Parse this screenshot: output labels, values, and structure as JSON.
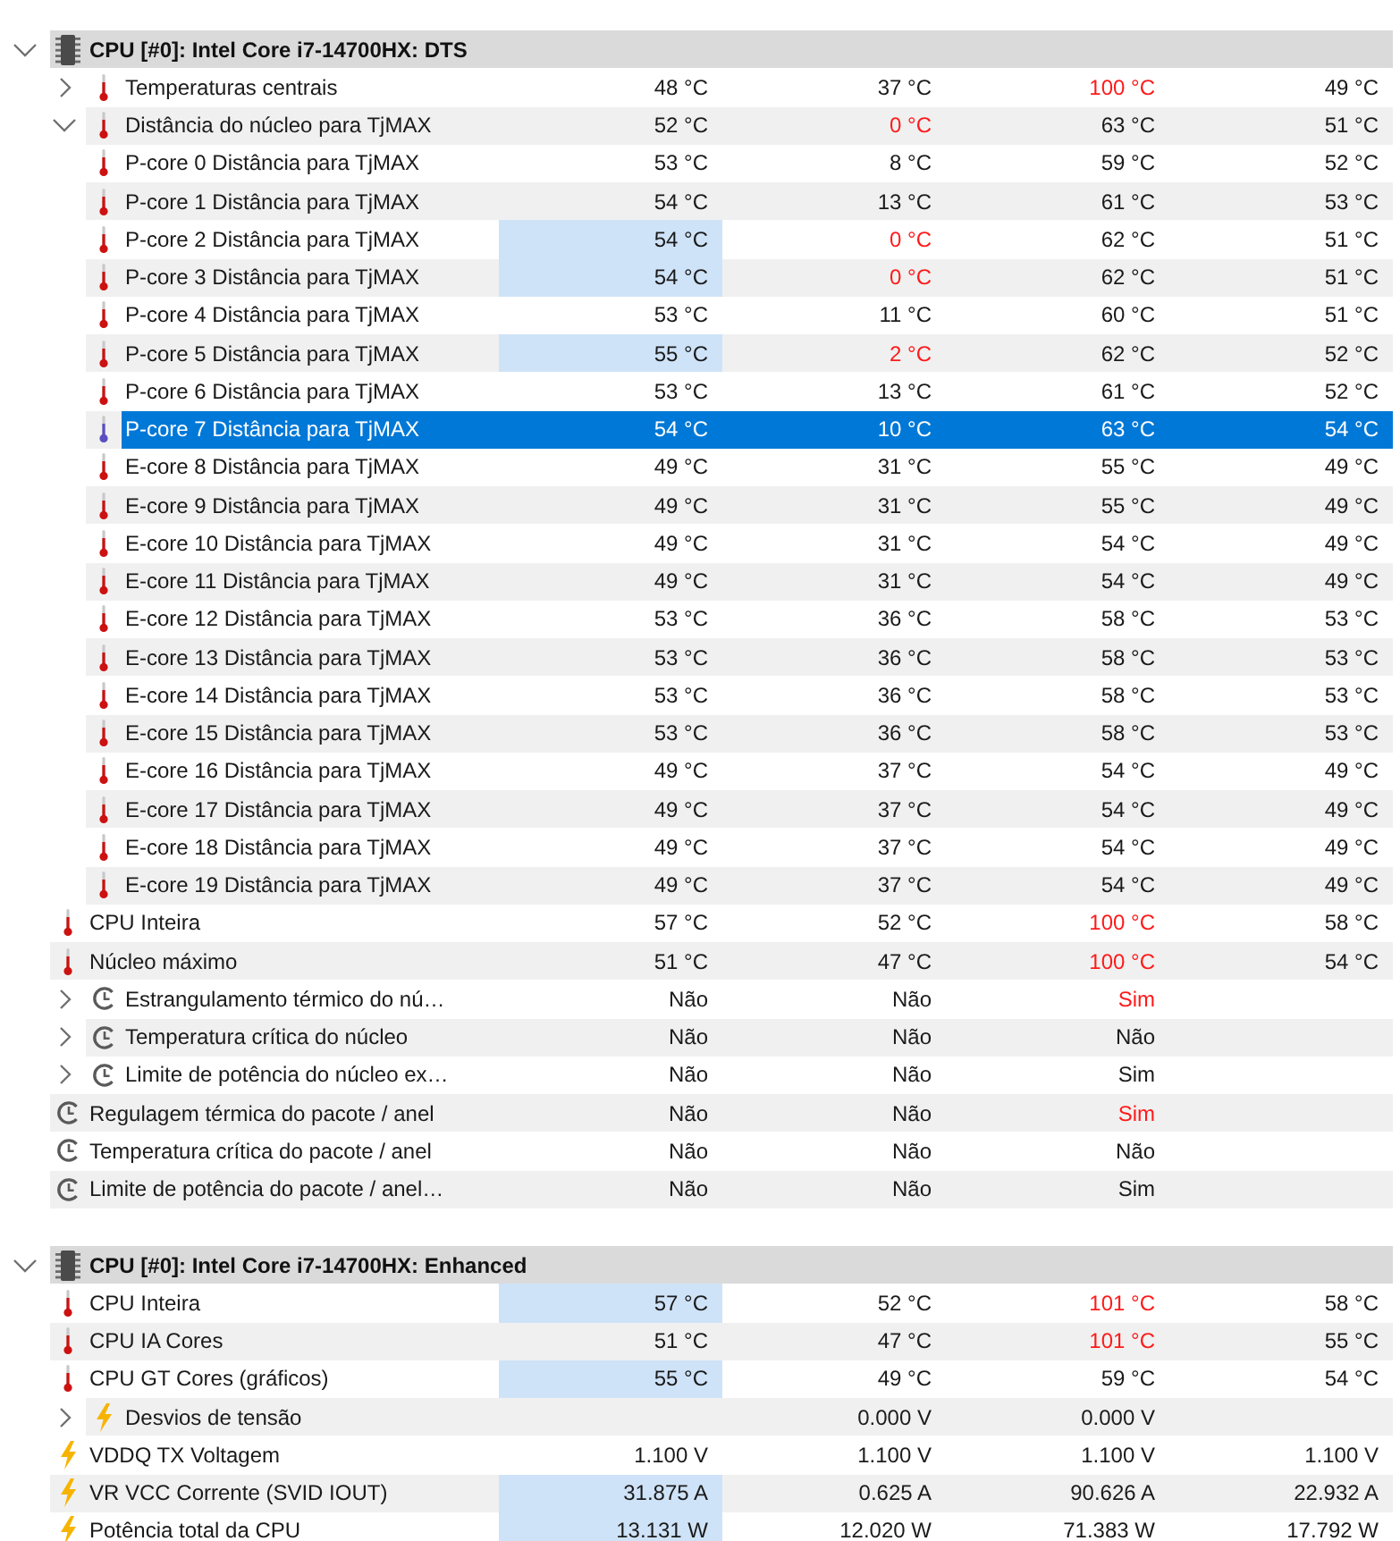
{
  "sections": [
    {
      "title": "CPU [#0]: Intel Core i7-14700HX: DTS",
      "expanded": true,
      "items": [
        {
          "kind": "temperature",
          "label": "Temperaturas centrais",
          "expanded": false,
          "selected": false,
          "highlighted": false,
          "cells": {
            "column_1": {
              "text": "48 °C",
              "alert": false
            },
            "column_2": {
              "text": "37 °C",
              "alert": false
            },
            "column_3": {
              "text": "100 °C",
              "alert": true
            },
            "column_4": {
              "text": "49 °C",
              "alert": false
            }
          }
        },
        {
          "kind": "temperature",
          "label": "Distância do núcleo para TjMAX",
          "expanded": true,
          "selected": false,
          "highlighted": false,
          "cells": {
            "column_1": {
              "text": "52 °C",
              "alert": false
            },
            "column_2": {
              "text": "0 °C",
              "alert": true
            },
            "column_3": {
              "text": "63 °C",
              "alert": false
            },
            "column_4": {
              "text": "51 °C",
              "alert": false
            }
          },
          "children": [
            {
              "kind": "temperature",
              "label": "P-core 0 Distância para TjMAX",
              "selected": false,
              "highlighted": false,
              "cells": {
                "column_1": {
                  "text": "53 °C",
                  "alert": false
                },
                "column_2": {
                  "text": "8 °C",
                  "alert": false
                },
                "column_3": {
                  "text": "59 °C",
                  "alert": false
                },
                "column_4": {
                  "text": "52 °C",
                  "alert": false
                }
              }
            },
            {
              "kind": "temperature",
              "label": "P-core 1 Distância para TjMAX",
              "selected": false,
              "highlighted": false,
              "cells": {
                "column_1": {
                  "text": "54 °C",
                  "alert": false
                },
                "column_2": {
                  "text": "13 °C",
                  "alert": false
                },
                "column_3": {
                  "text": "61 °C",
                  "alert": false
                },
                "column_4": {
                  "text": "53 °C",
                  "alert": false
                }
              }
            },
            {
              "kind": "temperature",
              "label": "P-core 2 Distância para TjMAX",
              "selected": false,
              "highlighted": true,
              "cells": {
                "column_1": {
                  "text": "54 °C",
                  "alert": false
                },
                "column_2": {
                  "text": "0 °C",
                  "alert": true
                },
                "column_3": {
                  "text": "62 °C",
                  "alert": false
                },
                "column_4": {
                  "text": "51 °C",
                  "alert": false
                }
              }
            },
            {
              "kind": "temperature",
              "label": "P-core 3 Distância para TjMAX",
              "selected": false,
              "highlighted": true,
              "cells": {
                "column_1": {
                  "text": "54 °C",
                  "alert": false
                },
                "column_2": {
                  "text": "0 °C",
                  "alert": true
                },
                "column_3": {
                  "text": "62 °C",
                  "alert": false
                },
                "column_4": {
                  "text": "51 °C",
                  "alert": false
                }
              }
            },
            {
              "kind": "temperature",
              "label": "P-core 4 Distância para TjMAX",
              "selected": false,
              "highlighted": false,
              "cells": {
                "column_1": {
                  "text": "53 °C",
                  "alert": false
                },
                "column_2": {
                  "text": "11 °C",
                  "alert": false
                },
                "column_3": {
                  "text": "60 °C",
                  "alert": false
                },
                "column_4": {
                  "text": "51 °C",
                  "alert": false
                }
              }
            },
            {
              "kind": "temperature",
              "label": "P-core 5 Distância para TjMAX",
              "selected": false,
              "highlighted": true,
              "cells": {
                "column_1": {
                  "text": "55 °C",
                  "alert": false
                },
                "column_2": {
                  "text": "2 °C",
                  "alert": true
                },
                "column_3": {
                  "text": "62 °C",
                  "alert": false
                },
                "column_4": {
                  "text": "52 °C",
                  "alert": false
                }
              }
            },
            {
              "kind": "temperature",
              "label": "P-core 6 Distância para TjMAX",
              "selected": false,
              "highlighted": false,
              "cells": {
                "column_1": {
                  "text": "53 °C",
                  "alert": false
                },
                "column_2": {
                  "text": "13 °C",
                  "alert": false
                },
                "column_3": {
                  "text": "61 °C",
                  "alert": false
                },
                "column_4": {
                  "text": "52 °C",
                  "alert": false
                }
              }
            },
            {
              "kind": "temperature",
              "label": "P-core 7 Distância para TjMAX",
              "selected": true,
              "highlighted": false,
              "cells": {
                "column_1": {
                  "text": "54 °C",
                  "alert": false
                },
                "column_2": {
                  "text": "10 °C",
                  "alert": false
                },
                "column_3": {
                  "text": "63 °C",
                  "alert": false
                },
                "column_4": {
                  "text": "54 °C",
                  "alert": false
                }
              }
            },
            {
              "kind": "temperature",
              "label": "E-core 8 Distância para TjMAX",
              "selected": false,
              "highlighted": false,
              "cells": {
                "column_1": {
                  "text": "49 °C",
                  "alert": false
                },
                "column_2": {
                  "text": "31 °C",
                  "alert": false
                },
                "column_3": {
                  "text": "55 °C",
                  "alert": false
                },
                "column_4": {
                  "text": "49 °C",
                  "alert": false
                }
              }
            },
            {
              "kind": "temperature",
              "label": "E-core 9 Distância para TjMAX",
              "selected": false,
              "highlighted": false,
              "cells": {
                "column_1": {
                  "text": "49 °C",
                  "alert": false
                },
                "column_2": {
                  "text": "31 °C",
                  "alert": false
                },
                "column_3": {
                  "text": "55 °C",
                  "alert": false
                },
                "column_4": {
                  "text": "49 °C",
                  "alert": false
                }
              }
            },
            {
              "kind": "temperature",
              "label": "E-core 10 Distância para TjMAX",
              "selected": false,
              "highlighted": false,
              "cells": {
                "column_1": {
                  "text": "49 °C",
                  "alert": false
                },
                "column_2": {
                  "text": "31 °C",
                  "alert": false
                },
                "column_3": {
                  "text": "54 °C",
                  "alert": false
                },
                "column_4": {
                  "text": "49 °C",
                  "alert": false
                }
              }
            },
            {
              "kind": "temperature",
              "label": "E-core 11 Distância para TjMAX",
              "selected": false,
              "highlighted": false,
              "cells": {
                "column_1": {
                  "text": "49 °C",
                  "alert": false
                },
                "column_2": {
                  "text": "31 °C",
                  "alert": false
                },
                "column_3": {
                  "text": "54 °C",
                  "alert": false
                },
                "column_4": {
                  "text": "49 °C",
                  "alert": false
                }
              }
            },
            {
              "kind": "temperature",
              "label": "E-core 12 Distância para TjMAX",
              "selected": false,
              "highlighted": false,
              "cells": {
                "column_1": {
                  "text": "53 °C",
                  "alert": false
                },
                "column_2": {
                  "text": "36 °C",
                  "alert": false
                },
                "column_3": {
                  "text": "58 °C",
                  "alert": false
                },
                "column_4": {
                  "text": "53 °C",
                  "alert": false
                }
              }
            },
            {
              "kind": "temperature",
              "label": "E-core 13 Distância para TjMAX",
              "selected": false,
              "highlighted": false,
              "cells": {
                "column_1": {
                  "text": "53 °C",
                  "alert": false
                },
                "column_2": {
                  "text": "36 °C",
                  "alert": false
                },
                "column_3": {
                  "text": "58 °C",
                  "alert": false
                },
                "column_4": {
                  "text": "53 °C",
                  "alert": false
                }
              }
            },
            {
              "kind": "temperature",
              "label": "E-core 14 Distância para TjMAX",
              "selected": false,
              "highlighted": false,
              "cells": {
                "column_1": {
                  "text": "53 °C",
                  "alert": false
                },
                "column_2": {
                  "text": "36 °C",
                  "alert": false
                },
                "column_3": {
                  "text": "58 °C",
                  "alert": false
                },
                "column_4": {
                  "text": "53 °C",
                  "alert": false
                }
              }
            },
            {
              "kind": "temperature",
              "label": "E-core 15 Distância para TjMAX",
              "selected": false,
              "highlighted": false,
              "cells": {
                "column_1": {
                  "text": "53 °C",
                  "alert": false
                },
                "column_2": {
                  "text": "36 °C",
                  "alert": false
                },
                "column_3": {
                  "text": "58 °C",
                  "alert": false
                },
                "column_4": {
                  "text": "53 °C",
                  "alert": false
                }
              }
            },
            {
              "kind": "temperature",
              "label": "E-core 16 Distância para TjMAX",
              "selected": false,
              "highlighted": false,
              "cells": {
                "column_1": {
                  "text": "49 °C",
                  "alert": false
                },
                "column_2": {
                  "text": "37 °C",
                  "alert": false
                },
                "column_3": {
                  "text": "54 °C",
                  "alert": false
                },
                "column_4": {
                  "text": "49 °C",
                  "alert": false
                }
              }
            },
            {
              "kind": "temperature",
              "label": "E-core 17 Distância para TjMAX",
              "selected": false,
              "highlighted": false,
              "cells": {
                "column_1": {
                  "text": "49 °C",
                  "alert": false
                },
                "column_2": {
                  "text": "37 °C",
                  "alert": false
                },
                "column_3": {
                  "text": "54 °C",
                  "alert": false
                },
                "column_4": {
                  "text": "49 °C",
                  "alert": false
                }
              }
            },
            {
              "kind": "temperature",
              "label": "E-core 18 Distância para TjMAX",
              "selected": false,
              "highlighted": false,
              "cells": {
                "column_1": {
                  "text": "49 °C",
                  "alert": false
                },
                "column_2": {
                  "text": "37 °C",
                  "alert": false
                },
                "column_3": {
                  "text": "54 °C",
                  "alert": false
                },
                "column_4": {
                  "text": "49 °C",
                  "alert": false
                }
              }
            },
            {
              "kind": "temperature",
              "label": "E-core 19 Distância para TjMAX",
              "selected": false,
              "highlighted": false,
              "cells": {
                "column_1": {
                  "text": "49 °C",
                  "alert": false
                },
                "column_2": {
                  "text": "37 °C",
                  "alert": false
                },
                "column_3": {
                  "text": "54 °C",
                  "alert": false
                },
                "column_4": {
                  "text": "49 °C",
                  "alert": false
                }
              }
            }
          ]
        },
        {
          "kind": "temperature",
          "label": "CPU Inteira",
          "selected": false,
          "highlighted": false,
          "cells": {
            "column_1": {
              "text": "57 °C",
              "alert": false
            },
            "column_2": {
              "text": "52 °C",
              "alert": false
            },
            "column_3": {
              "text": "100 °C",
              "alert": true
            },
            "column_4": {
              "text": "58 °C",
              "alert": false
            }
          }
        },
        {
          "kind": "temperature",
          "label": "Núcleo máximo",
          "selected": false,
          "highlighted": false,
          "cells": {
            "column_1": {
              "text": "51 °C",
              "alert": false
            },
            "column_2": {
              "text": "47 °C",
              "alert": false
            },
            "column_3": {
              "text": "100 °C",
              "alert": true
            },
            "column_4": {
              "text": "54 °C",
              "alert": false
            }
          }
        },
        {
          "kind": "throttle",
          "label": "Estrangulamento térmico do nú…",
          "expanded": false,
          "selected": false,
          "highlighted": false,
          "cells": {
            "column_1": {
              "text": "Não",
              "alert": false
            },
            "column_2": {
              "text": "Não",
              "alert": false
            },
            "column_3": {
              "text": "Sim",
              "alert": true
            }
          }
        },
        {
          "kind": "throttle",
          "label": "Temperatura crítica do núcleo",
          "expanded": false,
          "selected": false,
          "highlighted": false,
          "cells": {
            "column_1": {
              "text": "Não",
              "alert": false
            },
            "column_2": {
              "text": "Não",
              "alert": false
            },
            "column_3": {
              "text": "Não",
              "alert": false
            }
          }
        },
        {
          "kind": "throttle",
          "label": "Limite de potência do núcleo ex…",
          "expanded": false,
          "selected": false,
          "highlighted": false,
          "cells": {
            "column_1": {
              "text": "Não",
              "alert": false
            },
            "column_2": {
              "text": "Não",
              "alert": false
            },
            "column_3": {
              "text": "Sim",
              "alert": false
            }
          }
        },
        {
          "kind": "throttle",
          "label": "Regulagem térmica do pacote / anel",
          "selected": false,
          "highlighted": false,
          "cells": {
            "column_1": {
              "text": "Não",
              "alert": false
            },
            "column_2": {
              "text": "Não",
              "alert": false
            },
            "column_3": {
              "text": "Sim",
              "alert": true
            }
          }
        },
        {
          "kind": "throttle",
          "label": "Temperatura crítica do pacote / anel",
          "selected": false,
          "highlighted": false,
          "cells": {
            "column_1": {
              "text": "Não",
              "alert": false
            },
            "column_2": {
              "text": "Não",
              "alert": false
            },
            "column_3": {
              "text": "Não",
              "alert": false
            }
          }
        },
        {
          "kind": "throttle",
          "label": "Limite de potência do pacote / anel…",
          "selected": false,
          "highlighted": false,
          "cells": {
            "column_1": {
              "text": "Não",
              "alert": false
            },
            "column_2": {
              "text": "Não",
              "alert": false
            },
            "column_3": {
              "text": "Sim",
              "alert": false
            }
          }
        }
      ]
    },
    {
      "title": "CPU [#0]: Intel Core i7-14700HX: Enhanced",
      "expanded": true,
      "items": [
        {
          "kind": "temperature",
          "label": "CPU Inteira",
          "selected": false,
          "highlighted": true,
          "cells": {
            "column_1": {
              "text": "57 °C",
              "alert": false
            },
            "column_2": {
              "text": "52 °C",
              "alert": false
            },
            "column_3": {
              "text": "101 °C",
              "alert": true
            },
            "column_4": {
              "text": "58 °C",
              "alert": false
            }
          }
        },
        {
          "kind": "temperature",
          "label": "CPU IA Cores",
          "selected": false,
          "highlighted": false,
          "cells": {
            "column_1": {
              "text": "51 °C",
              "alert": false
            },
            "column_2": {
              "text": "47 °C",
              "alert": false
            },
            "column_3": {
              "text": "101 °C",
              "alert": true
            },
            "column_4": {
              "text": "55 °C",
              "alert": false
            }
          }
        },
        {
          "kind": "temperature",
          "label": "CPU GT Cores (gráficos)",
          "selected": false,
          "highlighted": true,
          "cells": {
            "column_1": {
              "text": "55 °C",
              "alert": false
            },
            "column_2": {
              "text": "49 °C",
              "alert": false
            },
            "column_3": {
              "text": "59 °C",
              "alert": false
            },
            "column_4": {
              "text": "54 °C",
              "alert": false
            }
          }
        },
        {
          "kind": "electric",
          "label": "Desvios de tensão",
          "expanded": false,
          "selected": false,
          "highlighted": false,
          "cells": {
            "column_2": {
              "text": "0.000 V",
              "alert": false
            },
            "column_3": {
              "text": "0.000 V",
              "alert": false
            }
          }
        },
        {
          "kind": "electric",
          "label": "VDDQ TX Voltagem",
          "selected": false,
          "highlighted": false,
          "cells": {
            "column_1": {
              "text": "1.100 V",
              "alert": false
            },
            "column_2": {
              "text": "1.100 V",
              "alert": false
            },
            "column_3": {
              "text": "1.100 V",
              "alert": false
            },
            "column_4": {
              "text": "1.100 V",
              "alert": false
            }
          }
        },
        {
          "kind": "electric",
          "label": "VR VCC Corrente (SVID IOUT)",
          "selected": false,
          "highlighted": true,
          "cells": {
            "column_1": {
              "text": "31.875 A",
              "alert": false
            },
            "column_2": {
              "text": "0.625 A",
              "alert": false
            },
            "column_3": {
              "text": "90.626 A",
              "alert": false
            },
            "column_4": {
              "text": "22.932 A",
              "alert": false
            }
          }
        },
        {
          "kind": "electric",
          "label": "Potência total da CPU",
          "selected": false,
          "highlighted": true,
          "cells": {
            "column_1": {
              "text": "13.131 W",
              "alert": false
            },
            "column_2": {
              "text": "12.020 W",
              "alert": false
            },
            "column_3": {
              "text": "71.383 W",
              "alert": false
            },
            "column_4": {
              "text": "17.792 W",
              "alert": false
            }
          }
        }
      ]
    }
  ]
}
